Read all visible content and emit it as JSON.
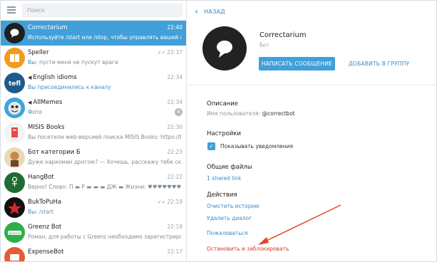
{
  "search": {
    "placeholder": "Поиск"
  },
  "chats": [
    {
      "title": "Correctarium",
      "time": "22:40",
      "preview": "Используйте /start или /stop, чтобы управлять вашей подпиской",
      "active": true
    },
    {
      "title": "Speller",
      "time": "22:37",
      "preview_hl": "Вы: ",
      "preview": "пусти меня не пускут враги",
      "check": true
    },
    {
      "title": "English idioms",
      "time": "22:34",
      "preview_hl": "Вы присоединились к каналу",
      "preview": "",
      "mega": true
    },
    {
      "title": "AllMemes",
      "time": "22:34",
      "preview_hl": "Фото",
      "preview": "",
      "mega": true,
      "badge": "4"
    },
    {
      "title": "MISIS Books",
      "time": "22:30",
      "preview_hl": "",
      "preview": "Вы посетили web-версией поиска MISIS Books: https://t.me/..."
    },
    {
      "title": "Бот категории Б",
      "time": "22:23",
      "preview_hl": "",
      "preview": "Дуже наркоман дрогою? — Хочешь, расскажу тебе сказку..."
    },
    {
      "title": "HangBot",
      "time": "22:22",
      "preview_hl": "",
      "preview": "Верно! Слово: П ▬ Р ▬ ▬ ▬ ДЖ ▬ Жизни: ♥♥♥♥♥♥♥"
    },
    {
      "title": "BukToPuHa",
      "time": "22:19",
      "preview_hl": "Вы: ",
      "preview": "/start",
      "check": true
    },
    {
      "title": "Greenz Bot",
      "time": "22:19",
      "preview_hl": "",
      "preview": "Роман, для работы с Greenz необходимо зарегистрировать..."
    },
    {
      "title": "ExpenseBot",
      "time": "22:17",
      "preview_hl": "",
      "preview": ""
    }
  ],
  "back_label": "НАЗАД",
  "profile": {
    "name": "Correctarium",
    "subtitle": "бот",
    "write_button": "НАПИСАТЬ СООБЩЕНИЕ",
    "group_button": "ДОБАВИТЬ В ГРУППУ"
  },
  "description": {
    "heading": "Описание",
    "username_label": "Имя пользователя: ",
    "username": "@correctbot"
  },
  "settings": {
    "heading": "Настройки",
    "notifications_label": "Показывать уведомления",
    "notifications_checked": true
  },
  "files": {
    "heading": "Общие файлы",
    "shared_link": "1 shared link"
  },
  "actions": {
    "heading": "Действия",
    "clear_history": "Очистить историю",
    "delete_dialog": "Удалить диалог",
    "report": "Пожаловаться",
    "stop_block": "Остановить и заблокировать"
  },
  "colors": {
    "accent": "#419fd9",
    "link": "#3a8ac7",
    "danger": "#d23c2c",
    "annotation_arrow": "#e8432a"
  }
}
